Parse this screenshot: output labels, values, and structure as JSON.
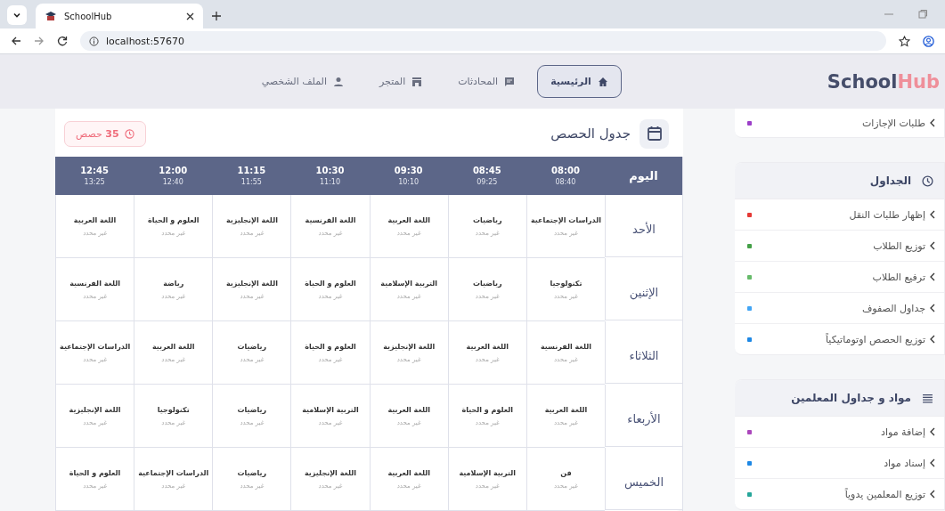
{
  "browser": {
    "tab_title": "SchoolHub",
    "url": "localhost:57670"
  },
  "nav": {
    "logo_1": "School",
    "logo_2": "Hub",
    "items": [
      {
        "label": "الرئيسية",
        "selected": true
      },
      {
        "label": "المحادثات",
        "selected": false
      },
      {
        "label": "المتجر",
        "selected": false
      },
      {
        "label": "الملف الشخصي",
        "selected": false
      }
    ]
  },
  "sidebar": {
    "sections": [
      {
        "items": [
          {
            "label": "طلبات الإجازات",
            "color": "#9c3fc8"
          }
        ]
      },
      {
        "title": "الجداول",
        "items": [
          {
            "label": "إظهار طلبات النقل",
            "color": "#e53935"
          },
          {
            "label": "توزيع الطلاب",
            "color": "#43a047"
          },
          {
            "label": "ترفيع الطلاب",
            "color": "#66bb6a"
          },
          {
            "label": "جداول الصفوف",
            "color": "#42a5f5"
          },
          {
            "label": "توزيع الحصص اوتوماتيكياً",
            "color": "#1e88e5"
          }
        ]
      },
      {
        "title": "مواد و جداول المعلمين",
        "items": [
          {
            "label": "إضافة مواد",
            "color": "#ab47bc"
          },
          {
            "label": "إسناد مواد",
            "color": "#1e88e5"
          },
          {
            "label": "توزيع المعلمين يدوياً",
            "color": "#26a69a"
          }
        ]
      }
    ]
  },
  "schedule": {
    "title": "جدول الحصص",
    "badge": "**35** حصص",
    "day_header": "اليوم",
    "periods": [
      {
        "start": "08:00",
        "end": "08:40"
      },
      {
        "start": "08:45",
        "end": "09:25"
      },
      {
        "start": "09:30",
        "end": "10:10"
      },
      {
        "start": "10:30",
        "end": "11:10"
      },
      {
        "start": "11:15",
        "end": "11:55"
      },
      {
        "start": "12:00",
        "end": "12:40"
      },
      {
        "start": "12:45",
        "end": "13:25"
      }
    ],
    "rows": [
      {
        "day": "الأحد",
        "cells": [
          {
            "subject": "الدراسات الإجتماعية",
            "teacher": "غير محدد"
          },
          {
            "subject": "رياضيات",
            "teacher": "غير محدد"
          },
          {
            "subject": "اللغة العربية",
            "teacher": "غير محدد"
          },
          {
            "subject": "اللغة الفرنسية",
            "teacher": "غير محدد"
          },
          {
            "subject": "اللغة الإنجليزية",
            "teacher": "غير محدد"
          },
          {
            "subject": "العلوم و الحياة",
            "teacher": "غير محدد"
          },
          {
            "subject": "اللغة العربية",
            "teacher": "غير محدد"
          }
        ]
      },
      {
        "day": "الإثنين",
        "cells": [
          {
            "subject": "تكنولوجيا",
            "teacher": "غير محدد"
          },
          {
            "subject": "رياضيات",
            "teacher": "غير محدد"
          },
          {
            "subject": "التربية الإسلامية",
            "teacher": "غير محدد"
          },
          {
            "subject": "العلوم و الحياة",
            "teacher": "غير محدد"
          },
          {
            "subject": "اللغة الإنجليزية",
            "teacher": "غير محدد"
          },
          {
            "subject": "رياضة",
            "teacher": "غير محدد"
          },
          {
            "subject": "اللغة الفرنسية",
            "teacher": "غير محدد"
          }
        ]
      },
      {
        "day": "الثلاثاء",
        "cells": [
          {
            "subject": "اللغة الفرنسية",
            "teacher": "غير محدد"
          },
          {
            "subject": "اللغة العربية",
            "teacher": "غير محدد"
          },
          {
            "subject": "اللغة الإنجليزية",
            "teacher": "غير محدد"
          },
          {
            "subject": "العلوم و الحياة",
            "teacher": "غير محدد"
          },
          {
            "subject": "رياضيات",
            "teacher": "غير محدد"
          },
          {
            "subject": "اللغة العربية",
            "teacher": "غير محدد"
          },
          {
            "subject": "الدراسات الإجتماعية",
            "teacher": "غير محدد"
          }
        ]
      },
      {
        "day": "الأربعاء",
        "cells": [
          {
            "subject": "اللغة العربية",
            "teacher": "غير محدد"
          },
          {
            "subject": "العلوم و الحياة",
            "teacher": "غير محدد"
          },
          {
            "subject": "اللغة العربية",
            "teacher": "غير محدد"
          },
          {
            "subject": "التربية الإسلامية",
            "teacher": "غير محدد"
          },
          {
            "subject": "رياضيات",
            "teacher": "غير محدد"
          },
          {
            "subject": "تكنولوجيا",
            "teacher": "غير محدد"
          },
          {
            "subject": "اللغة الإنجليزية",
            "teacher": "غير محدد"
          }
        ]
      },
      {
        "day": "الخميس",
        "cells": [
          {
            "subject": "فن",
            "teacher": "غير محدد"
          },
          {
            "subject": "التربية الإسلامية",
            "teacher": "غير محدد"
          },
          {
            "subject": "اللغة العربية",
            "teacher": "غير محدد"
          },
          {
            "subject": "اللغة الإنجليزية",
            "teacher": "غير محدد"
          },
          {
            "subject": "رياضيات",
            "teacher": "غير محدد"
          },
          {
            "subject": "الدراسات الإجتماعية",
            "teacher": "غير محدد"
          },
          {
            "subject": "العلوم و الحياة",
            "teacher": "غير محدد"
          }
        ]
      }
    ]
  }
}
